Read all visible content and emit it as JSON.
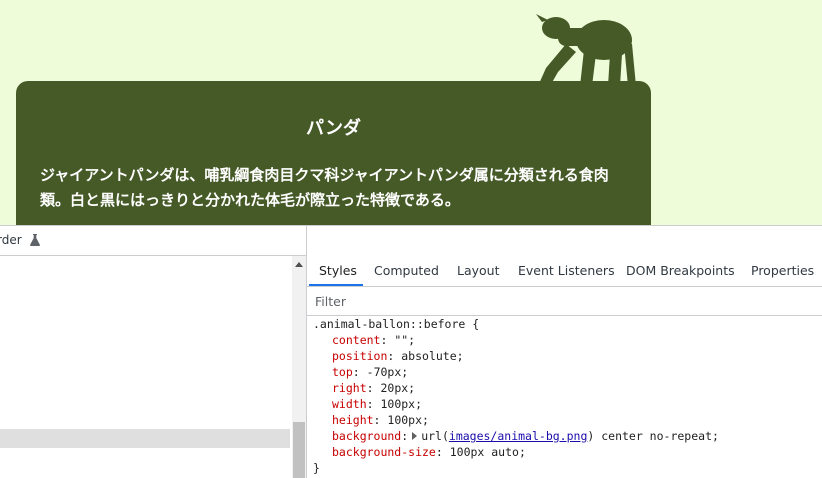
{
  "page": {
    "balloon_title": "パンダ",
    "balloon_body": "ジャイアントパンダは、哺乳綱食肉目クマ科ジャイアントパンダ属に分類される食肉類。白と黒にはっきりと分かれた体毛が際立った特徴である。",
    "colors": {
      "viewport_bg": "#eefcd9",
      "balloon_bg": "#465a27",
      "silhouette": "#465a27"
    }
  },
  "devtools": {
    "topbar_label": "rder",
    "topbar_icon": "flask-icon",
    "tabs": [
      {
        "label": "Styles",
        "active": true
      },
      {
        "label": "Computed",
        "active": false
      },
      {
        "label": "Layout",
        "active": false
      },
      {
        "label": "Event Listeners",
        "active": false
      },
      {
        "label": "DOM Breakpoints",
        "active": false
      },
      {
        "label": "Properties",
        "active": false
      }
    ],
    "filter_placeholder": "Filter",
    "rule": {
      "selector": ".animal-ballon::before {",
      "declarations": [
        {
          "prop": "content",
          "value": "\"\";"
        },
        {
          "prop": "position",
          "value": "absolute;"
        },
        {
          "prop": "top",
          "value": "-70px;"
        },
        {
          "prop": "right",
          "value": "20px;"
        },
        {
          "prop": "width",
          "value": "100px;"
        },
        {
          "prop": "height",
          "value": "100px;"
        },
        {
          "prop": "background",
          "value_before": "url(",
          "url": "images/animal-bg.png",
          "value_after": ") center no-repeat;"
        },
        {
          "prop": "background-size",
          "value": "100px auto;"
        }
      ],
      "close": "}"
    },
    "colors": {
      "accent": "#1a73e8",
      "property": "#c80000",
      "link": "#1a0dab"
    }
  }
}
